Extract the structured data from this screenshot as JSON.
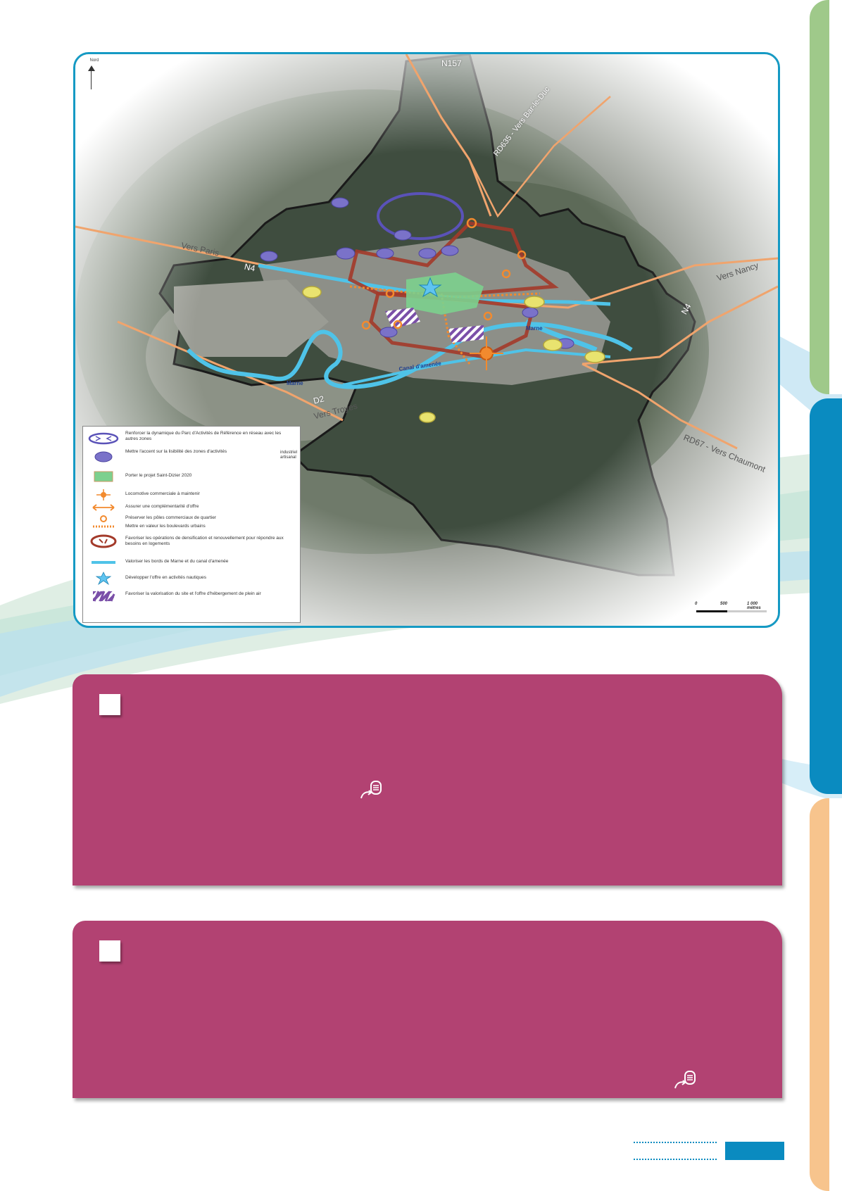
{
  "colors": {
    "tab_green": "#9fc98a",
    "tab_blue": "#0a8bc0",
    "tab_orange": "#f7c48d",
    "panel": "#b24272",
    "map_border": "#159ac4",
    "river": "#4fc3e8",
    "commune_outline": "#222222",
    "dense_zone": "#a33a2a",
    "park_zone": "#5a52b8"
  },
  "map": {
    "north_label": "Nord",
    "roads": {
      "n157": "N157",
      "rd635": "RD635 - Vers Bar-le-Duc",
      "vers_paris": "Vers Paris",
      "n4_west": "N4",
      "vers_nancy": "Vers Nancy",
      "n4_east": "N4",
      "marne_east": "Marne",
      "marne_west": "Marne",
      "canal": "Canal d'amenée",
      "d2": "D2",
      "vers_troyes": "Vers Troyes",
      "rd67": "RD67 - Vers Chaumont"
    },
    "legend": [
      {
        "icon": "park-ellipse-icon",
        "text": "Renforcer la dynamique du Parc d'Activités de Référence en réseau avec les autres zones"
      },
      {
        "icon": "purple-ellipse-icon",
        "text": "Mettre l'accent sur la lisibilité des zones d'activités",
        "side": "industriel artisanal"
      },
      {
        "icon": "green-rect-icon",
        "text": "Porter le projet Saint-Dizier 2020"
      },
      {
        "icon": "locomotive-icon",
        "text": "Locomotive commerciale à maintenir"
      },
      {
        "icon": "double-arrow-icon",
        "text": "Assurer une complémentarité d'offre"
      },
      {
        "icon": "small-circle-icon",
        "text": "Préserver les pôles commerciaux de quartier"
      },
      {
        "icon": "dotted-line-icon",
        "text": "Mettre en valeur les boulevards urbains"
      },
      {
        "icon": "dense-zone-icon",
        "text": "Favoriser les opérations de densification et renouvellement pour répondre aux besoins en logements"
      },
      {
        "icon": "blue-line-icon",
        "text": "Valoriser les bords de Marne et du canal d'amenée"
      },
      {
        "icon": "star-icon",
        "text": "Développer l'offre en activités nautiques"
      },
      {
        "icon": "hatch-icon",
        "text": "Favoriser la valorisation du site et l'offre d'hébergement de plein air"
      }
    ],
    "scale": {
      "zero": "0",
      "mid": "500",
      "end": "1 000 mètres"
    }
  },
  "panels": [
    {
      "icon": "document-link-icon"
    },
    {
      "icon": "document-link-icon"
    }
  ]
}
